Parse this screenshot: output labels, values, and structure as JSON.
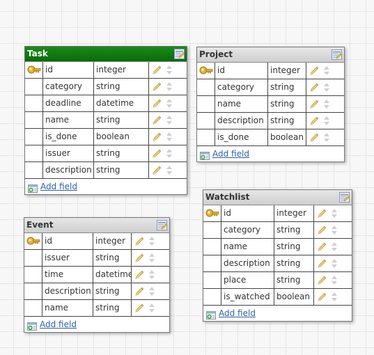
{
  "icons": {
    "primary_key": "key-icon",
    "edit_field": "pencil-icon",
    "reorder": "up-down-arrows-icon",
    "edit_table": "edit-table-icon",
    "add_field": "add-field-icon"
  },
  "colors": {
    "selected_header": "#0a6a0a",
    "link": "#2d5fa8"
  },
  "tables": [
    {
      "name": "Task",
      "selected": true,
      "add_label": "Add field",
      "fields": [
        {
          "name": "id",
          "type": "integer",
          "primary": true
        },
        {
          "name": "category",
          "type": "string",
          "primary": false
        },
        {
          "name": "deadline",
          "type": "datetime",
          "primary": false
        },
        {
          "name": "name",
          "type": "string",
          "primary": false
        },
        {
          "name": "is_done",
          "type": "boolean",
          "primary": false
        },
        {
          "name": "issuer",
          "type": "string",
          "primary": false
        },
        {
          "name": "description",
          "type": "string",
          "primary": false
        }
      ]
    },
    {
      "name": "Project",
      "selected": false,
      "add_label": "Add field",
      "fields": [
        {
          "name": "id",
          "type": "integer",
          "primary": true
        },
        {
          "name": "category",
          "type": "string",
          "primary": false
        },
        {
          "name": "name",
          "type": "string",
          "primary": false
        },
        {
          "name": "description",
          "type": "string",
          "primary": false
        },
        {
          "name": "is_done",
          "type": "boolean",
          "primary": false
        }
      ]
    },
    {
      "name": "Event",
      "selected": false,
      "add_label": "Add field",
      "fields": [
        {
          "name": "id",
          "type": "integer",
          "primary": true
        },
        {
          "name": "issuer",
          "type": "string",
          "primary": false
        },
        {
          "name": "time",
          "type": "datetime",
          "primary": false
        },
        {
          "name": "description",
          "type": "string",
          "primary": false
        },
        {
          "name": "name",
          "type": "string",
          "primary": false
        }
      ]
    },
    {
      "name": "Watchlist",
      "selected": false,
      "add_label": "Add field",
      "fields": [
        {
          "name": "id",
          "type": "integer",
          "primary": true
        },
        {
          "name": "category",
          "type": "string",
          "primary": false
        },
        {
          "name": "name",
          "type": "string",
          "primary": false
        },
        {
          "name": "description",
          "type": "string",
          "primary": false
        },
        {
          "name": "place",
          "type": "string",
          "primary": false
        },
        {
          "name": "is_watched",
          "type": "boolean",
          "primary": false
        }
      ]
    }
  ]
}
